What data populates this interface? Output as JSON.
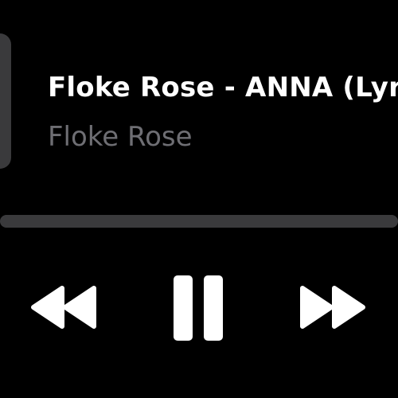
{
  "now_playing": {
    "title": "Floke Rose - ANNA (Lyrics)",
    "artist": "Floke Rose",
    "progress": 0.0
  },
  "controls": {
    "rewind_icon": "rewind-icon",
    "pause_icon": "pause-icon",
    "forward_icon": "fast-forward-icon"
  },
  "colors": {
    "background": "#000000",
    "title": "#ffffff",
    "artist": "#6e6e73",
    "track": "#3a3a3c",
    "icon": "#ffffff"
  }
}
